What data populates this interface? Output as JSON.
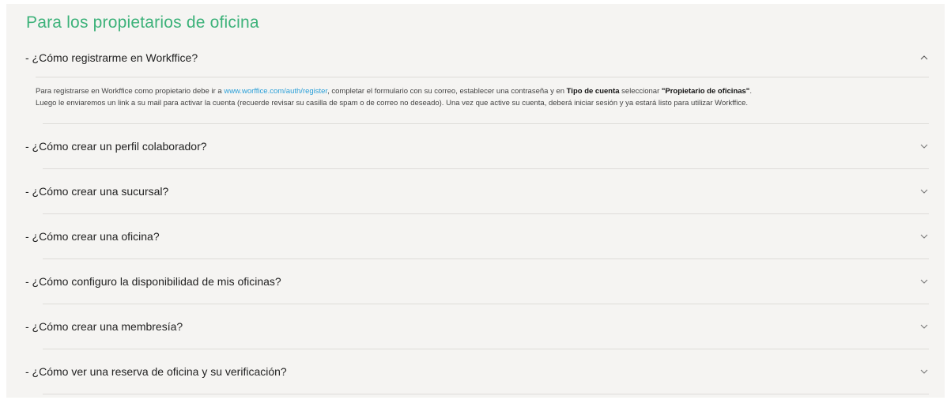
{
  "section": {
    "title": "Para los propietarios de oficina"
  },
  "faq": {
    "open_item": {
      "question": "- ¿Cómo registrarme en Workffice?",
      "answer": {
        "p1": "Para registrarse en Workffice como propietario debe ir a ",
        "link": "www.worffice.com/auth/register",
        "p2": ", completar el formulario con su correo, establecer una contraseña y en ",
        "bold1": "Tipo de cuenta",
        "p3": " seleccionar ",
        "bold2": "\"Propietario de oficinas\"",
        "p4": ".",
        "line2": "Luego le enviaremos un link a su mail para activar la cuenta (recuerde revisar su casilla de spam o de correo no deseado). Una vez que active su cuenta, deberá iniciar sesión y ya estará listo para utilizar Workffice."
      },
      "icon": "chevron-up-icon"
    },
    "items": [
      {
        "question": "- ¿Cómo crear un perfil colaborador?",
        "icon": "chevron-down-icon"
      },
      {
        "question": "- ¿Cómo crear una sucursal?",
        "icon": "chevron-down-icon"
      },
      {
        "question": "- ¿Cómo crear una oficina?",
        "icon": "chevron-down-icon"
      },
      {
        "question": "- ¿Cómo configuro la disponibilidad de mis oficinas?",
        "icon": "chevron-down-icon"
      },
      {
        "question": "- ¿Cómo crear una membresía?",
        "icon": "chevron-down-icon"
      },
      {
        "question": "- ¿Cómo ver una reserva de oficina y su verificación?",
        "icon": "chevron-down-icon"
      }
    ]
  },
  "colors": {
    "title": "#3db27a",
    "link": "#2a9fd8",
    "panel": "#f5f4f2"
  }
}
